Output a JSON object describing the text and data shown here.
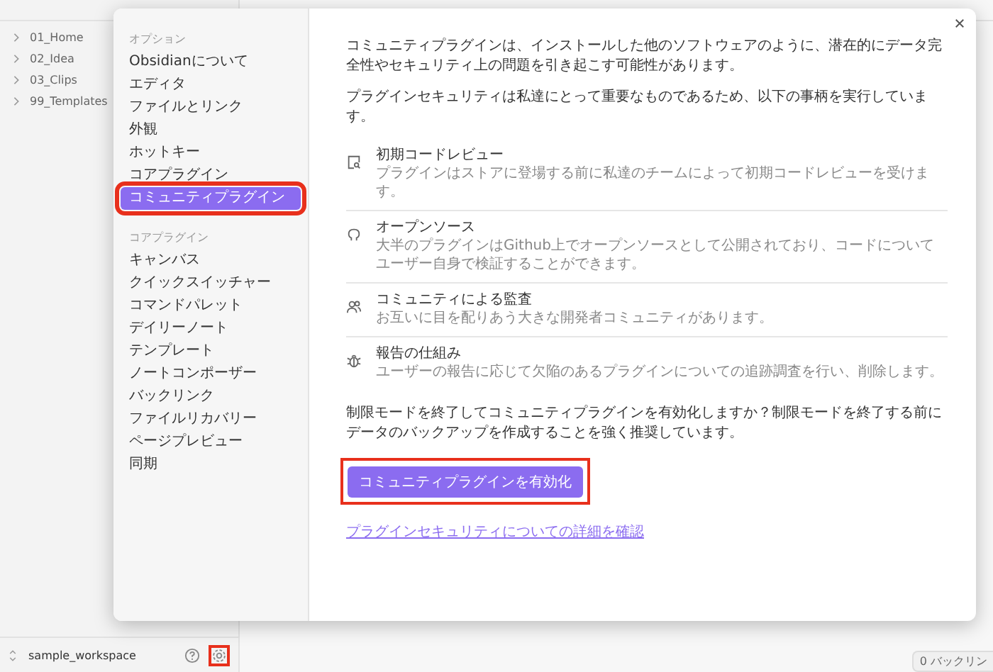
{
  "file_tree": [
    {
      "label": "01_Home",
      "expanded": false
    },
    {
      "label": "02_Idea",
      "expanded": false
    },
    {
      "label": "03_Clips",
      "expanded": false
    },
    {
      "label": "99_Templates",
      "expanded": false
    }
  ],
  "vault": {
    "name": "sample_workspace"
  },
  "footer_icons": [
    {
      "kind": "help",
      "annotated": false
    },
    {
      "kind": "settings",
      "annotated": true
    }
  ],
  "status_bar": {
    "backlinks": "0 バックリン"
  },
  "settings": {
    "nav_sections": [
      {
        "heading": "オプション",
        "items": [
          {
            "label": "Obsidianについて",
            "selected": false,
            "annotated": false
          },
          {
            "label": "エディタ",
            "selected": false,
            "annotated": false
          },
          {
            "label": "ファイルとリンク",
            "selected": false,
            "annotated": false
          },
          {
            "label": "外観",
            "selected": false,
            "annotated": false
          },
          {
            "label": "ホットキー",
            "selected": false,
            "annotated": false
          },
          {
            "label": "コアプラグイン",
            "selected": false,
            "annotated": false
          },
          {
            "label": "コミュニティプラグイン",
            "selected": true,
            "annotated": true
          }
        ]
      },
      {
        "heading": "コアプラグイン",
        "items": [
          {
            "label": "キャンバス",
            "selected": false,
            "annotated": false
          },
          {
            "label": "クイックスイッチャー",
            "selected": false,
            "annotated": false
          },
          {
            "label": "コマンドパレット",
            "selected": false,
            "annotated": false
          },
          {
            "label": "デイリーノート",
            "selected": false,
            "annotated": false
          },
          {
            "label": "テンプレート",
            "selected": false,
            "annotated": false
          },
          {
            "label": "ノートコンポーザー",
            "selected": false,
            "annotated": false
          },
          {
            "label": "バックリンク",
            "selected": false,
            "annotated": false
          },
          {
            "label": "ファイルリカバリー",
            "selected": false,
            "annotated": false
          },
          {
            "label": "ページプレビュー",
            "selected": false,
            "annotated": false
          },
          {
            "label": "同期",
            "selected": false,
            "annotated": false
          }
        ]
      }
    ],
    "intro": "コミュニティプラグインは、インストールした他のソフトウェアのように、潜在的にデータ完全性やセキュリティ上の問題を引き起こす可能性があります。",
    "lead": "プラグインセキュリティは私達にとって重要なものであるため、以下の事柄を実行しています。",
    "measures": [
      {
        "kind": "review",
        "title": "初期コードレビュー",
        "description": "プラグインはストアに登場する前に私達のチームによって初期コードレビューを受けます。"
      },
      {
        "kind": "source",
        "title": "オープンソース",
        "description": "大半のプラグインはGithub上でオープンソースとして公開されており、コードについてユーザー自身で検証することができます。"
      },
      {
        "kind": "community",
        "title": "コミュニティによる監査",
        "description": "お互いに目を配りあう大きな開発者コミュニティがあります。"
      },
      {
        "kind": "report",
        "title": "報告の仕組み",
        "description": "ユーザーの報告に応じて欠陥のあるプラグインについての追跡調査を行い、削除します。"
      }
    ],
    "warning": "制限モードを終了してコミュニティプラグインを有効化しますか？制限モードを終了する前にデータのバックアップを作成することを強く推奨しています。",
    "enable_button": {
      "label": "コミュニティプラグインを有効化",
      "annotated": true
    },
    "details_link": "プラグインセキュリティについての詳細を確認"
  }
}
